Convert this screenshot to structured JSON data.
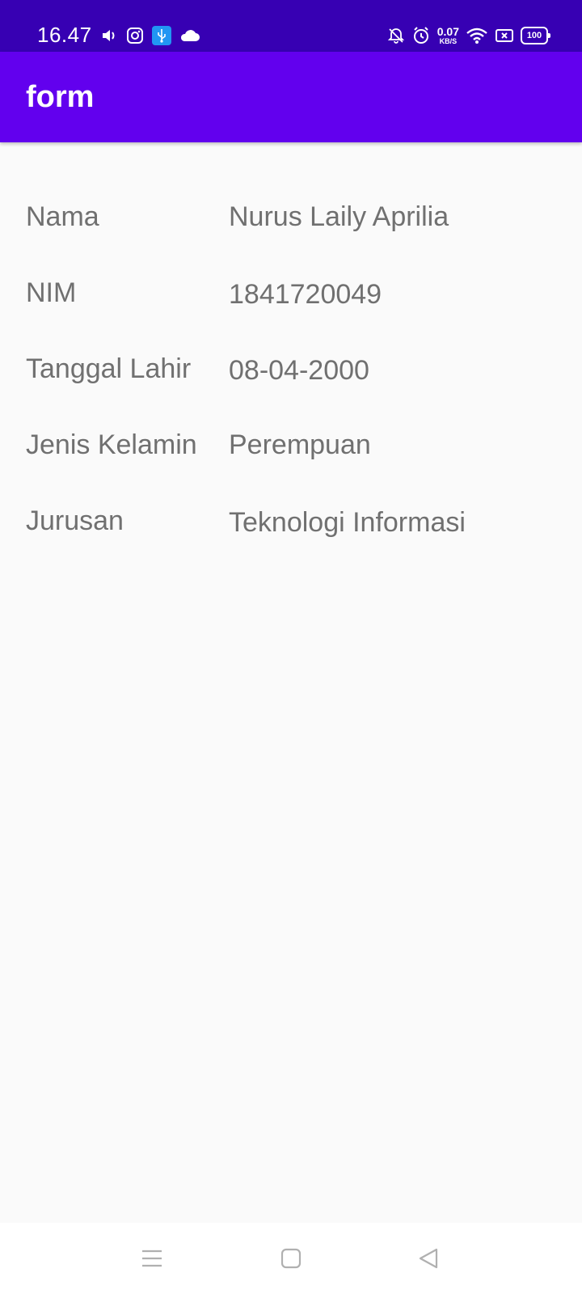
{
  "status_bar": {
    "time": "16.47",
    "icons_left": [
      "volume-icon",
      "instagram-icon",
      "usb-icon",
      "cloud-icon"
    ],
    "icons_right": [
      "bell-off-icon",
      "alarm-icon",
      "net-speed",
      "wifi-icon",
      "sim-icon",
      "battery-icon"
    ],
    "net_speed_value": "0.07",
    "net_speed_unit": "KB/S",
    "battery_level": "100"
  },
  "app_bar": {
    "title": "form",
    "color": "#6200ee",
    "status_color": "#3700b3"
  },
  "form": {
    "rows": [
      {
        "label": "Nama",
        "value": "Nurus Laily Aprilia"
      },
      {
        "label": "NIM",
        "value": "1841720049"
      },
      {
        "label": "Tanggal Lahir",
        "value": "08-04-2000"
      },
      {
        "label": "Jenis Kelamin",
        "value": "Perempuan"
      },
      {
        "label": "Jurusan",
        "value": "Teknologi Informasi"
      }
    ]
  },
  "nav_bar": {
    "buttons": [
      "menu-icon",
      "home-icon",
      "back-icon"
    ]
  }
}
